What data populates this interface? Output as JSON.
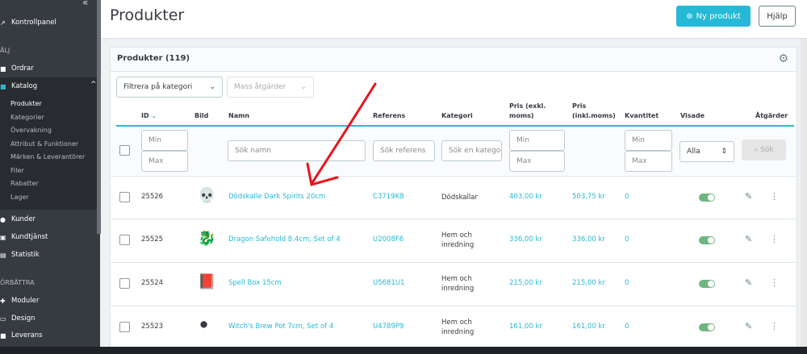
{
  "sidebar": {
    "top": "Kontrollpanel",
    "sec1": "ÄLJ",
    "orders": "Ordrar",
    "catalog": "Katalog",
    "sub": [
      "Produkter",
      "Kategorier",
      "Övervakning",
      "Attribut & Funktioner",
      "Märken & Leverantörer",
      "Filer",
      "Rabatter",
      "Lager"
    ],
    "customers": "Kunder",
    "service": "Kundtjänst",
    "stats": "Statistik",
    "sec2": "ÖRBÄTTRA",
    "modules": "Moduler",
    "design": "Design",
    "shipping": "Leverans"
  },
  "header": {
    "title": "Produkter",
    "new_product": "Ny produkt",
    "help": "Hjälp"
  },
  "card": {
    "title": "Produkter (119)",
    "filter_category": "Filtrera på kategori",
    "bulk": "Mass åtgärder"
  },
  "columns": {
    "id": "ID",
    "image": "Bild",
    "name": "Namn",
    "reference": "Referens",
    "category": "Kategori",
    "price_ex1": "Pris (exkl.",
    "price_ex2": "moms)",
    "price_in1": "Pris",
    "price_in2": "(inkl.moms)",
    "quantity": "Kvantitet",
    "shown": "Visade",
    "actions": "Åtgärder"
  },
  "filters": {
    "min": "Min",
    "max": "Max",
    "name_ph": "Sök namn",
    "ref_ph": "Sök referens",
    "cat_ph": "Sök en kategori",
    "shown": "Alla",
    "search": "Sök"
  },
  "rows": [
    {
      "id": "25526",
      "name": "Dödskalle Dark Spirits 20cm",
      "ref": "C3719K8",
      "cat1": "Dödskallar",
      "cat2": "",
      "price_ex": "403,00 kr",
      "price_in": "503,75 kr",
      "qty": "0"
    },
    {
      "id": "25525",
      "name": "Dragon Safehold 8.4cm, Set of 4",
      "ref": "U2008F6",
      "cat1": "Hem och",
      "cat2": "inredning",
      "price_ex": "336,00 kr",
      "price_in": "336,00 kr",
      "qty": "0"
    },
    {
      "id": "25524",
      "name": "Spell Box 15cm",
      "ref": "U5681U1",
      "cat1": "Hem och",
      "cat2": "inredning",
      "price_ex": "215,00 kr",
      "price_in": "215,00 kr",
      "qty": "0"
    },
    {
      "id": "25523",
      "name": "Witch's Brew Pot 7cm, Set of 4",
      "ref": "U4789P9",
      "cat1": "Hem och",
      "cat2": "inredning",
      "price_ex": "161,00 kr",
      "price_in": "161,00 kr",
      "qty": "0"
    }
  ]
}
